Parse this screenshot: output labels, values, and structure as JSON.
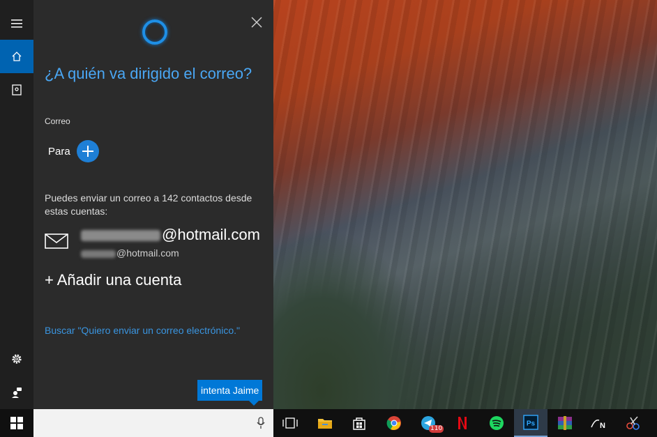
{
  "cortana": {
    "question": "¿A quién va dirigido el correo?",
    "section_label": "Correo",
    "to_label": "Para",
    "info_text": "Puedes enviar un correo a 142 contactos desde estas cuentas:",
    "account_domain": "@hotmail.com",
    "account_sub_domain": "@hotmail.com",
    "add_account": "+ Añadir una cuenta",
    "search_link": "Buscar \"Quiero enviar un correo electrónico.\""
  },
  "tooltip": {
    "text": "intenta Jaime"
  },
  "taskbar": {
    "apps": [
      {
        "name": "task-view",
        "badge": ""
      },
      {
        "name": "file-explorer",
        "badge": ""
      },
      {
        "name": "store",
        "badge": ""
      },
      {
        "name": "chrome",
        "badge": ""
      },
      {
        "name": "telegram",
        "badge": "110"
      },
      {
        "name": "netflix",
        "badge": ""
      },
      {
        "name": "spotify",
        "badge": ""
      },
      {
        "name": "photoshop",
        "badge": ""
      },
      {
        "name": "winrar",
        "badge": ""
      },
      {
        "name": "app-n",
        "badge": ""
      },
      {
        "name": "snipping-tool",
        "badge": ""
      }
    ]
  },
  "colors": {
    "accent": "#0078d7",
    "rail_active": "#0063b1",
    "question": "#4aa7f4",
    "link": "#3a95e0",
    "panel_bg": "#2b2b2b"
  }
}
